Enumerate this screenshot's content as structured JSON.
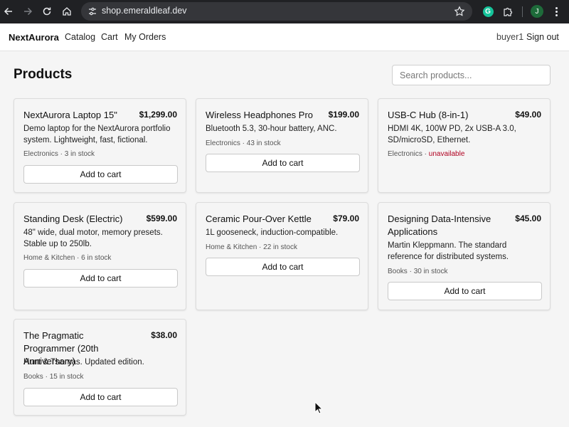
{
  "browser": {
    "url": "shop.emeraldleaf.dev",
    "profile_initial": "J",
    "extension_initial": "G"
  },
  "header": {
    "brand": "NextAurora",
    "nav": [
      "Catalog",
      "Cart",
      "My Orders"
    ],
    "user": "buyer1",
    "sign_out": "Sign out"
  },
  "main": {
    "title": "Products",
    "search_placeholder": "Search products..."
  },
  "products": [
    {
      "name": "NextAurora Laptop 15\"",
      "price": "$1,299.00",
      "description": "Demo laptop for the NextAurora portfolio system. Lightweight, fast, fictional.",
      "category": "Electronics · ",
      "stock": "3 in stock",
      "button": "Add to cart"
    },
    {
      "name": "Wireless Headphones Pro",
      "price": "$199.00",
      "description": "Bluetooth 5.3, 30-hour battery, ANC.",
      "category": "Electronics · ",
      "stock": "43 in stock",
      "button": "Add to cart"
    },
    {
      "name": "USB-C Hub (8-in-1)",
      "price": "$49.00",
      "description": "HDMI 4K, 100W PD, 2x USB-A 3.0, SD/microSD, Ethernet.",
      "category": "Electronics · ",
      "stock": "unavailable"
    },
    {
      "name": "Standing Desk (Electric)",
      "price": "$599.00",
      "description": "48\" wide, dual motor, memory presets. Stable up to 250lb.",
      "category": "Home & Kitchen · ",
      "stock": "6 in stock",
      "button": "Add to cart"
    },
    {
      "name": "Ceramic Pour-Over Kettle",
      "price": "$79.00",
      "description": "1L gooseneck, induction-compatible.",
      "category": "Home & Kitchen · ",
      "stock": "22 in stock",
      "button": "Add to cart"
    },
    {
      "name": "Designing Data-Intensive Applications",
      "price": "$45.00",
      "description": "Martin Kleppmann. The standard reference for distributed systems.",
      "category": "Books · ",
      "stock": "30 in stock",
      "button": "Add to cart"
    },
    {
      "name": "The Pragmatic Programmer (20th Anniversary)",
      "price": "$38.00",
      "description": "Hunt & Thomas. Updated edition.",
      "category": "Books · ",
      "stock": "15 in stock",
      "button": "Add to cart"
    }
  ],
  "colors": {
    "unavailable": "#b00020",
    "chrome_bg": "#202124",
    "page_bg": "#f5f5f5"
  }
}
